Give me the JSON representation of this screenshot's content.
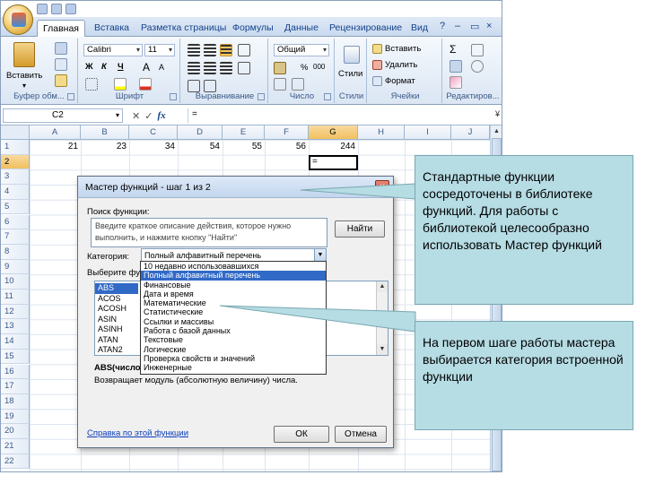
{
  "ribbon": {
    "tabs": [
      "Главная",
      "Вставка",
      "Разметка страницы",
      "Формулы",
      "Данные",
      "Рецензирование",
      "Вид"
    ],
    "window_controls": [
      "?",
      "–",
      "▭",
      "×"
    ],
    "groups": {
      "clipboard": {
        "label": "Буфер обм...",
        "paste": "Вставить"
      },
      "font": {
        "label": "Шрифт",
        "font_name": "Calibri",
        "font_size": "11",
        "bold": "Ж",
        "italic": "К",
        "underline": "Ч",
        "grow": "A",
        "shrink": "A"
      },
      "alignment": {
        "label": "Выравнивание"
      },
      "number": {
        "label": "Число",
        "format": "Общий",
        "percent": "%",
        "thousands": "000"
      },
      "styles": {
        "label": "Стили",
        "button": "Стили"
      },
      "cells": {
        "label": "Ячейки",
        "insert": "Вставить",
        "delete": "Удалить",
        "format": "Формат"
      },
      "editing": {
        "label": "Редактиров..."
      }
    }
  },
  "formula_bar": {
    "name_box": "C2",
    "fx": "fx",
    "content": "="
  },
  "sheet": {
    "columns": [
      "A",
      "B",
      "C",
      "D",
      "E",
      "F",
      "G",
      "H",
      "I",
      "J"
    ],
    "rows": [
      "1",
      "2",
      "3",
      "4",
      "5",
      "6",
      "7",
      "8",
      "9",
      "10",
      "11",
      "12",
      "13",
      "14",
      "15",
      "16",
      "17",
      "18",
      "19",
      "20",
      "21",
      "22"
    ],
    "row1_values": [
      "21",
      "23",
      "34",
      "54",
      "55",
      "56",
      "244"
    ],
    "active_cell_text": "="
  },
  "dialog": {
    "title": "Мастер функций - шаг 1 из 2",
    "close": "×",
    "search_label": "Поиск функции:",
    "search_placeholder": "Введите краткое описание действия, которое нужно выполнить, и нажмите кнопку \"Найти\"",
    "find_button": "Найти",
    "category_label": "Категория:",
    "category_value": "Полный алфавитный перечень",
    "select_label": "Выберите функцию:",
    "functions": [
      "ABS",
      "ACOS",
      "ACOSH",
      "ASIN",
      "ASINH",
      "ATAN",
      "ATAN2"
    ],
    "signature": "ABS(число)",
    "description": "Возвращает модуль (абсолютную величину) числа.",
    "help_link": "Справка по этой функции",
    "ok": "ОК",
    "cancel": "Отмена"
  },
  "category_dropdown": [
    "10 недавно использовавшихся",
    "Полный алфавитный перечень",
    "Финансовые",
    "Дата и время",
    "Математические",
    "Статистические",
    "Ссылки и массивы",
    "Работа с базой данных",
    "Текстовые",
    "Логические",
    "Проверка свойств и значений",
    "Инженерные"
  ],
  "callouts": {
    "top": "Стандартные функции сосредоточены в библиотеке функций. Для работы с библиотекой целесообразно использовать Мастер функций",
    "bottom": "На первом шаге работы мастера выбирается категория встроенной функции"
  },
  "colors": {
    "callout_fill": "#b6dce4",
    "list_selection": "#3169c6",
    "ribbon_text": "#15428b"
  }
}
